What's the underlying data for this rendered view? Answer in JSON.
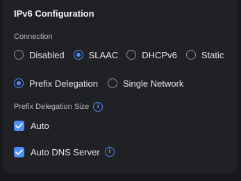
{
  "panel": {
    "title": "IPv6 Configuration"
  },
  "connection": {
    "label": "Connection",
    "options": [
      "Disabled",
      "SLAAC",
      "DHCPv6",
      "Static"
    ],
    "selected": "SLAAC"
  },
  "delegation": {
    "options": [
      "Prefix Delegation",
      "Single Network"
    ],
    "selected": "Prefix Delegation"
  },
  "prefix_size": {
    "label": "Prefix Delegation Size",
    "info_icon": "info-icon",
    "auto_label": "Auto",
    "auto_checked": true
  },
  "dns": {
    "label": "Auto DNS Server",
    "checked": true,
    "info_icon": "info-icon"
  },
  "colors": {
    "accent": "#4d8ef6",
    "panel_bg": "#202125",
    "page_bg": "#17181b"
  }
}
